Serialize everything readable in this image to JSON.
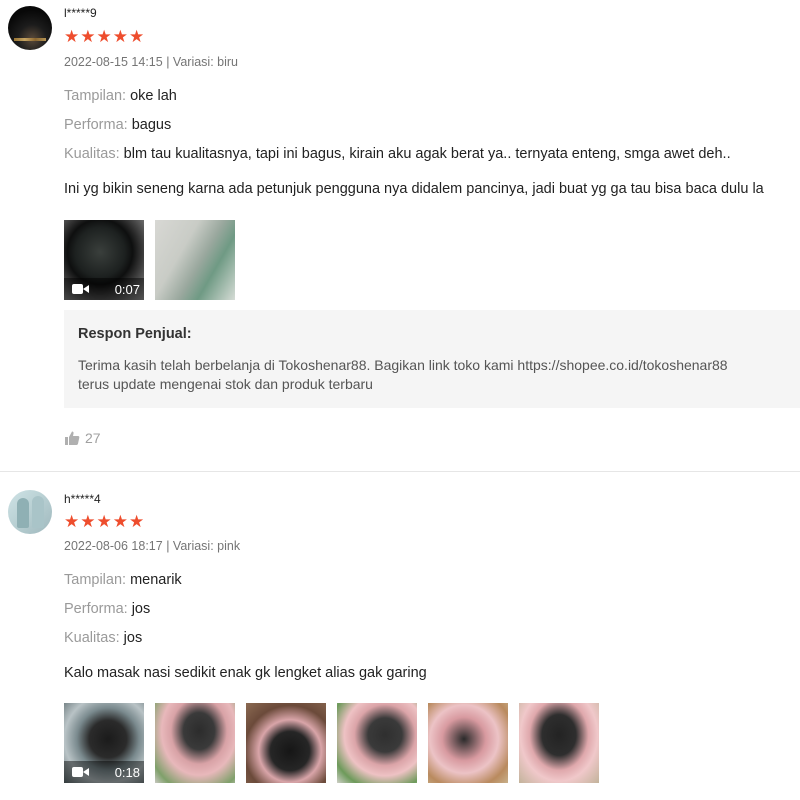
{
  "reviews": [
    {
      "username": "l*****9",
      "rating": 5,
      "stars": [
        "★",
        "★",
        "★",
        "★",
        "★"
      ],
      "date": "2022-08-15 14:15",
      "separator": "|",
      "variation": "Variasi: biru",
      "attributes": [
        {
          "key": "Tampilan:",
          "value": "oke lah"
        },
        {
          "key": "Performa:",
          "value": "bagus"
        },
        {
          "key": "Kualitas:",
          "value": "blm tau kualitasnya, tapi ini bagus, kirain aku agak berat ya.. ternyata enteng, smga awet deh.."
        }
      ],
      "comment": "Ini yg bikin seneng karna ada petunjuk pengguna nya didalem pancinya, jadi buat yg ga tau bisa baca dulu la",
      "video_duration": "0:07",
      "seller_response": {
        "title": "Respon Penjual:",
        "line1": "Terima kasih telah berbelanja di Tokoshenar88. Bagikan link toko kami https://shopee.co.id/tokoshenar88",
        "line2": "terus update mengenai stok dan produk terbaru"
      },
      "likes": "27"
    },
    {
      "username": "h*****4",
      "rating": 5,
      "stars": [
        "★",
        "★",
        "★",
        "★",
        "★"
      ],
      "date": "2022-08-06 18:17",
      "separator": "|",
      "variation": "Variasi: pink",
      "attributes": [
        {
          "key": "Tampilan:",
          "value": "menarik"
        },
        {
          "key": "Performa:",
          "value": "jos"
        },
        {
          "key": "Kualitas:",
          "value": "jos"
        }
      ],
      "comment": "Kalo masak nasi sedikit enak gk lengket alias gak garing",
      "video_duration": "0:18"
    }
  ],
  "colors": {
    "star": "#ee4d2d",
    "muted": "#9a9a9a",
    "seller_bg": "#f5f5f5"
  }
}
